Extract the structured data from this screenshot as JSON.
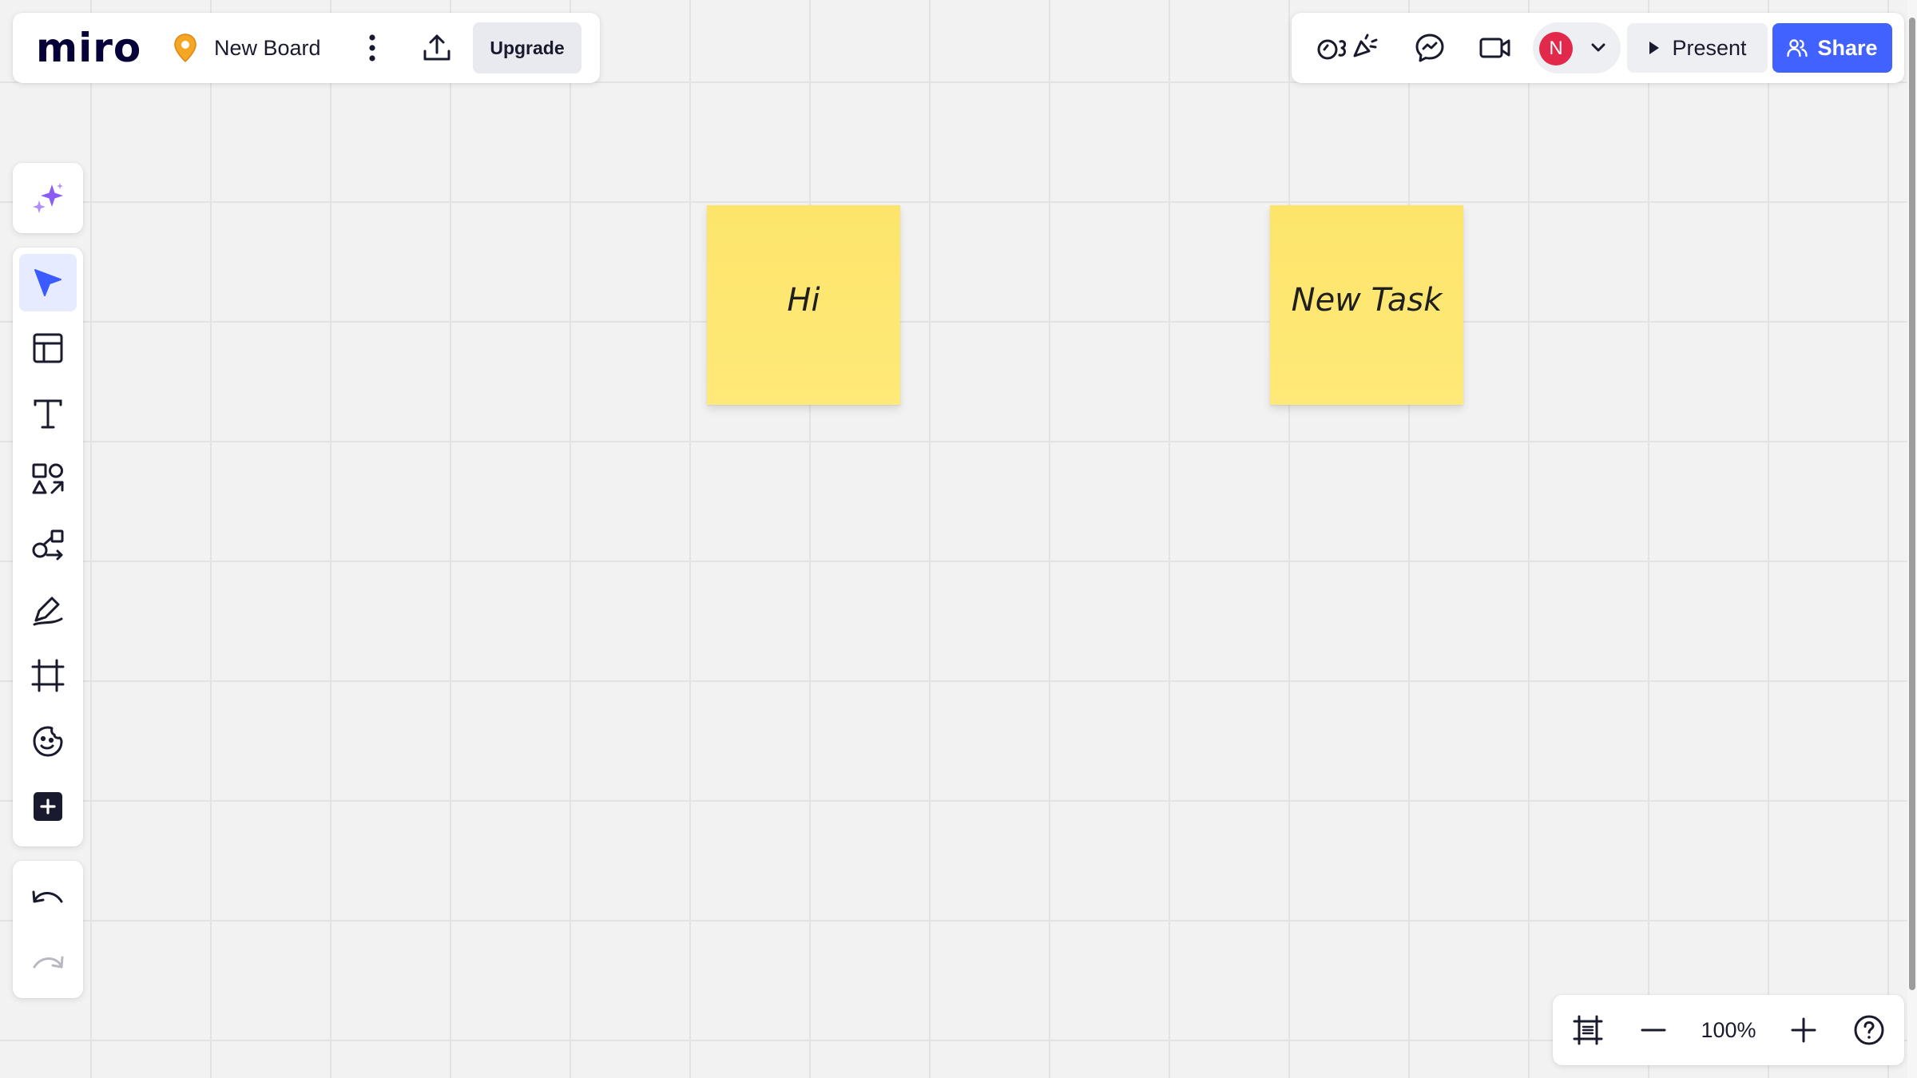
{
  "app": {
    "logo": "miro",
    "board_name": "New Board",
    "upgrade_label": "Upgrade"
  },
  "topbar": {
    "user_initial": "N",
    "present_label": "Present",
    "share_label": "Share"
  },
  "colors": {
    "brand_dark": "#050038",
    "accent_blue": "#4262ff",
    "sticky_yellow": "#fee570",
    "avatar_red": "#e2284b",
    "pin_orange": "#f5a623",
    "ai_purple": "#8a5cf6"
  },
  "toolbar": {
    "tools": [
      {
        "name": "ai-assist",
        "icon": "sparkle-icon"
      },
      {
        "name": "select",
        "icon": "cursor-icon",
        "active": true
      },
      {
        "name": "templates",
        "icon": "template-icon"
      },
      {
        "name": "text",
        "icon": "text-icon"
      },
      {
        "name": "shapes",
        "icon": "shapes-icon"
      },
      {
        "name": "connection-line",
        "icon": "diagram-icon"
      },
      {
        "name": "pen",
        "icon": "pen-icon"
      },
      {
        "name": "frame",
        "icon": "frame-icon"
      },
      {
        "name": "stickers",
        "icon": "emoji-sticker-icon"
      },
      {
        "name": "more-apps",
        "icon": "plus-square-icon"
      }
    ],
    "history": [
      {
        "name": "undo",
        "icon": "undo-icon"
      },
      {
        "name": "redo",
        "icon": "redo-icon",
        "disabled": true
      }
    ]
  },
  "board": {
    "stickies": [
      {
        "text": "Hi"
      },
      {
        "text": "New Task"
      }
    ]
  },
  "zoom": {
    "value": "100%"
  }
}
